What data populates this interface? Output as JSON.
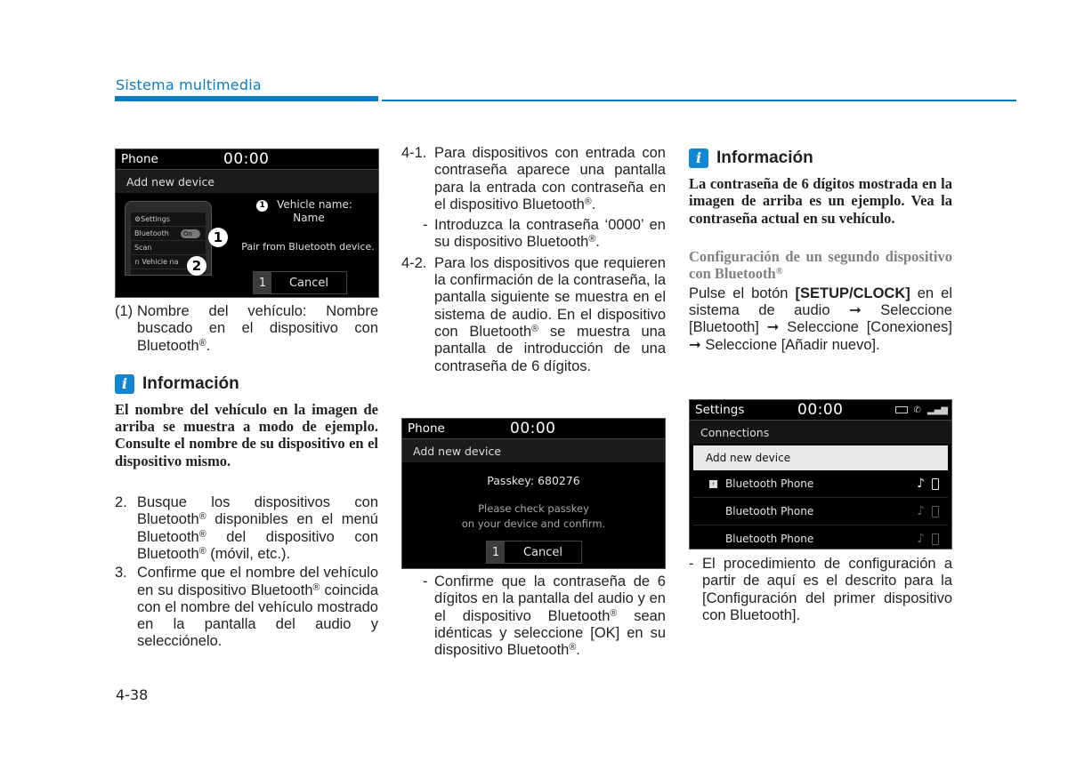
{
  "header": {
    "section_title": "Sistema multimedia",
    "accent_color": "#0a7cc1"
  },
  "page_number": "4-38",
  "screen1": {
    "app": "Phone",
    "clock": "00:00",
    "subtitle": "Add new device",
    "phone_settings": "⚙Settings",
    "phone_bluetooth": "Bluetooth",
    "phone_toggle": "On",
    "phone_scan": "Scan",
    "phone_vehicle": "∩ Vehicle na",
    "callout1": "1",
    "callout2": "2",
    "vehicle_name_label": "Vehicle name:",
    "vehicle_name_value": "Name",
    "pair_text": "Pair from Bluetooth device.",
    "cancel_key": "1",
    "cancel_label": "Cancel"
  },
  "col1": {
    "caption_num": "(1)",
    "caption_text": "Nombre del vehículo: Nombre buscado en el dispositivo con Bluetooth",
    "info_title": "Información",
    "info_body": "El nombre del vehículo en la imagen de arriba se muestra a modo de ejemplo. Consulte el nombre de su dispositivo en el dispositivo mismo.",
    "step2_num": "2.",
    "step2_a": "Busque los dispositivos con Bluetooth",
    "step2_b": " disponibles en el menú Bluetooth",
    "step2_c": " del dispositivo con Bluetooth",
    "step2_d": " (móvil, etc.).",
    "step3_num": "3.",
    "step3_a": "Confirme que el nombre del vehículo en su dispositivo Bluetooth",
    "step3_b": " coincida con el nombre del vehículo mostrado en la pantalla del audio y selecciónelo."
  },
  "col2": {
    "step41_num": "4-1.",
    "step41_text": "Para dispositivos con entrada con contraseña aparece una pantalla para la entrada con contraseña en el dispositivo Bluetooth",
    "step41_dash_text": "Introduzca la contraseña ‘0000’ en su dispositivo Bluetooth",
    "step42_num": "4-2.",
    "step42_a": "Para los dispositivos que requieren la confirmación de la contraseña, la pantalla siguiente se muestra en el sistema de audio. En el dispositivo con Bluetooth",
    "step42_b": " se muestra una pantalla de introducción de una contraseña de 6 dígitos.",
    "confirm_a": "Confirme que la contraseña de 6 dígitos en la pantalla del audio y en el dispositivo Bluetooth",
    "confirm_b": " sean idénticas y seleccione [OK] en su dispositivo Bluetooth",
    "dash": "-",
    "reg": "®",
    "period": "."
  },
  "screen2": {
    "app": "Phone",
    "clock": "00:00",
    "subtitle": "Add new device",
    "passkey": "Passkey: 680276",
    "message_line1": "Please check passkey",
    "message_line2": "on your device and confirm.",
    "cancel_key": "1",
    "cancel_label": "Cancel"
  },
  "col3": {
    "info_title": "Información",
    "info_body": "La contraseña de 6 dígitos mostrada en la imagen de arriba es un ejemplo. Vea la contraseña actual en su vehículo.",
    "subhead": "Configuración de un segundo dispositivo con Bluetooth",
    "instr_a": "Pulse el botón ",
    "instr_button": "[SETUP/CLOCK]",
    "instr_b": " en el sistema de audio ➞ Seleccione [Bluetooth] ➞ Seleccione [Conexiones] ➞ Seleccione [Añadir nuevo].",
    "note": "El procedimiento de configuración a partir de aquí es el descrito para la [Configuración del primer dispositivo con Bluetooth]."
  },
  "screen3": {
    "app": "Settings",
    "clock": "00:00",
    "status_icons": [
      "battery-icon",
      "phone-handset-icon",
      "signal-icon"
    ],
    "subtitle": "Connections",
    "add_new": "Add new device",
    "devices": [
      {
        "name": "Bluetooth Phone",
        "active": true
      },
      {
        "name": "Bluetooth Phone",
        "active": false
      },
      {
        "name": "Bluetooth Phone",
        "active": false
      }
    ]
  }
}
